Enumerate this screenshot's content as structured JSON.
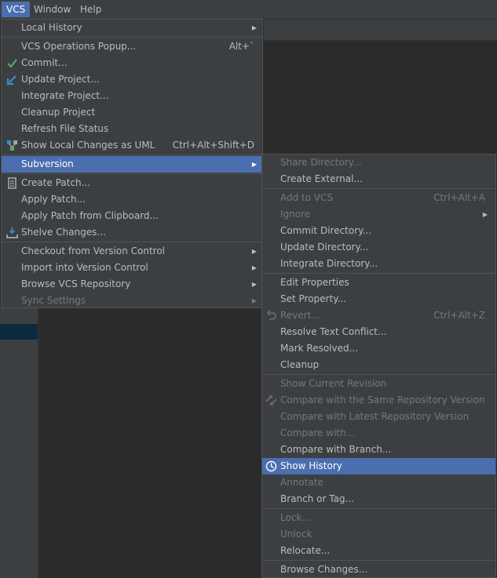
{
  "menubar": {
    "items": [
      "VCS",
      "Window",
      "Help"
    ]
  },
  "vcs_menu": {
    "local_history": "Local History",
    "vcs_operations_popup": "VCS Operations Popup...",
    "vcs_operations_popup_shortcut": "Alt+`",
    "commit": "Commit...",
    "update_project": "Update Project...",
    "integrate_project": "Integrate Project...",
    "cleanup_project": "Cleanup Project",
    "refresh_file_status": "Refresh File Status",
    "show_local_changes_uml": "Show Local Changes as UML",
    "show_local_changes_uml_shortcut": "Ctrl+Alt+Shift+D",
    "subversion": "Subversion",
    "create_patch": "Create Patch...",
    "apply_patch": "Apply Patch...",
    "apply_patch_clipboard": "Apply Patch from Clipboard...",
    "shelve_changes": "Shelve Changes...",
    "checkout": "Checkout from Version Control",
    "import": "Import into Version Control",
    "browse_vcs": "Browse VCS Repository",
    "sync_settings": "Sync Settings"
  },
  "subversion_menu": {
    "share_directory": "Share Directory...",
    "create_external": "Create External...",
    "add_to_vcs": "Add to VCS",
    "add_to_vcs_shortcut": "Ctrl+Alt+A",
    "ignore": "Ignore",
    "commit_directory": "Commit Directory...",
    "update_directory": "Update Directory...",
    "integrate_directory": "Integrate Directory...",
    "edit_properties": "Edit Properties",
    "set_property": "Set Property...",
    "revert": "Revert...",
    "revert_shortcut": "Ctrl+Alt+Z",
    "resolve_text_conflict": "Resolve Text Conflict...",
    "mark_resolved": "Mark Resolved...",
    "cleanup": "Cleanup",
    "show_current_revision": "Show Current Revision",
    "compare_same_repo": "Compare with the Same Repository Version",
    "compare_latest_repo": "Compare with Latest Repository Version",
    "compare_with": "Compare with...",
    "compare_with_branch": "Compare with Branch...",
    "show_history": "Show History",
    "annotate": "Annotate",
    "branch_or_tag": "Branch or Tag...",
    "lock": "Lock...",
    "unlock": "Unlock",
    "relocate": "Relocate...",
    "browse_changes": "Browse Changes..."
  },
  "colors": {
    "menu_background": "#3c3f41",
    "selection": "#4b6eaf",
    "text": "#bbbbbb",
    "disabled_text": "#777777",
    "commit_check": "#59a869",
    "update_arrow": "#3592c4"
  }
}
